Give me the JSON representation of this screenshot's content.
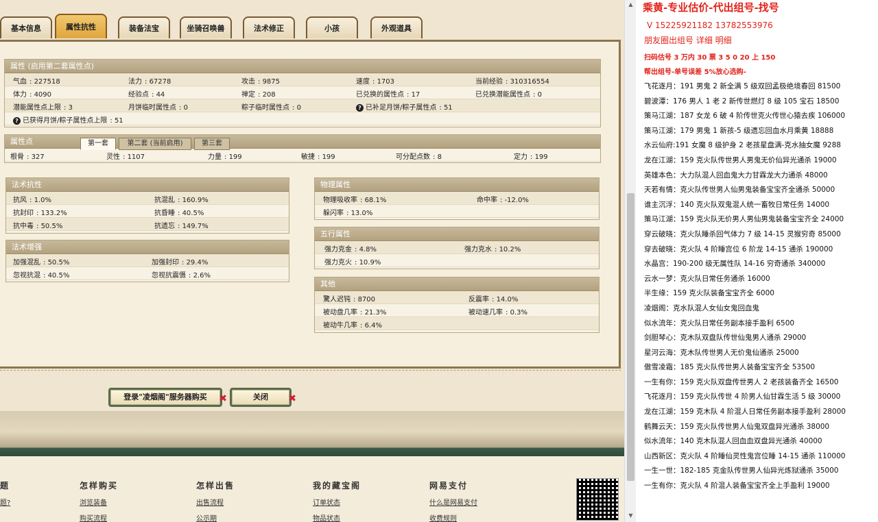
{
  "tabs": [
    "基本信息",
    "属性抗性",
    "装备法宝",
    "坐骑召唤兽",
    "法术修正",
    "小孩",
    "外观道具"
  ],
  "active_tab": 1,
  "attr_section": {
    "title": "属性 (启用第二套属性点)",
    "rows": [
      [
        [
          "气血",
          "227518"
        ],
        [
          "法力",
          "67278"
        ],
        [
          "攻击",
          "9875"
        ],
        [
          "速度",
          "1703"
        ],
        [
          "当前经验",
          "310316554"
        ]
      ],
      [
        [
          "体力",
          "4090"
        ],
        [
          "经验点",
          "44"
        ],
        [
          "禅定",
          "208"
        ],
        [
          "已兑换的属性点",
          "17"
        ],
        [
          "已兑换潜能属性点",
          "0"
        ]
      ],
      [
        [
          "潜能属性点上限",
          "3"
        ],
        [
          "月饼临时属性点",
          "0"
        ],
        [
          "粽子临时属性点",
          "0"
        ],
        [
          "已补足月饼/粽子属性点",
          "51"
        ]
      ],
      [
        [
          "已获得月饼/粽子属性点上限",
          "51"
        ]
      ]
    ]
  },
  "points_section": {
    "title": "属性点",
    "subtabs": [
      "第一套",
      "第二套 (当前启用)",
      "第三套"
    ],
    "cells": [
      [
        "根骨",
        "327"
      ],
      [
        "灵性",
        "1107"
      ],
      [
        "力量",
        "199"
      ],
      [
        "敏捷",
        "199"
      ],
      [
        "可分配点数",
        "8"
      ],
      [
        "定力",
        "199"
      ]
    ]
  },
  "spell_resist": {
    "title": "法术抗性",
    "rows": [
      [
        [
          "抗风",
          "1.0%"
        ],
        [
          "抗混乱",
          "160.9%"
        ]
      ],
      [
        [
          "抗封印",
          "133.2%"
        ],
        [
          "抗昏睡",
          "40.5%"
        ]
      ],
      [
        [
          "抗中毒",
          "50.5%"
        ],
        [
          "抗遗忘",
          "149.7%"
        ]
      ]
    ]
  },
  "spell_boost": {
    "title": "法术增强",
    "rows": [
      [
        [
          "加强混乱",
          "50.5%"
        ],
        [
          "加强封印",
          "29.4%"
        ]
      ],
      [
        [
          "忽视抗混",
          "40.5%"
        ],
        [
          "忽视抗震慑",
          "2.6%"
        ]
      ]
    ]
  },
  "phys": {
    "title": "物理属性",
    "rows": [
      [
        [
          "物理吸收率",
          "68.1%"
        ],
        [
          "命中率",
          "-12.0%"
        ]
      ],
      [
        [
          "躲闪率",
          "13.0%"
        ]
      ]
    ]
  },
  "five": {
    "title": "五行属性",
    "rows": [
      [
        [
          "强力克金",
          "4.8%"
        ],
        [
          "强力克水",
          "10.2%"
        ]
      ],
      [
        [
          "强力克火",
          "10.9%"
        ]
      ]
    ]
  },
  "other": {
    "title": "其他",
    "rows": [
      [
        [
          "驚人迟钝",
          "8700"
        ],
        [
          "反震率",
          "14.0%"
        ]
      ],
      [
        [
          "被动盘几率",
          "21.3%"
        ],
        [
          "被动速几率",
          "0.3%"
        ]
      ],
      [
        [
          "被动牛几率",
          "6.4%"
        ]
      ]
    ]
  },
  "buttons": {
    "buy": "登录\"凌烟阁\"服务器购买",
    "close": "关闭"
  },
  "footer": [
    {
      "title": "",
      "links": [
        "题?",
        ""
      ]
    },
    {
      "title": "怎样购买",
      "links": [
        "浏览装备",
        "购买流程"
      ]
    },
    {
      "title": "怎样出售",
      "links": [
        "出售流程",
        "公示期"
      ]
    },
    {
      "title": "我的藏宝阁",
      "links": [
        "订单状态",
        "物品状态"
      ]
    },
    {
      "title": "网易支付",
      "links": [
        "什么是网易支付",
        "收费规则"
      ]
    }
  ],
  "notes": {
    "title": "乘黄-专业估价-代出组号-找号",
    "phone": "V 15225921182   13782553976",
    "line3": "朋友圈出组号   详细   明细",
    "line4": "扫码估号 3 万内 30 票 3    5 0      20 上 150",
    "line5": "帮出组号-单号误差 5%放心选购-",
    "entries": [
      "飞花逐月：191 男鬼 2 新全满 5 级双回孟极绝境春回 81500",
      "碧波潭：176 男人 1 老 2 新传世燃灯 8 级 105 宝石 18500",
      "策马江湖：187 女龙 6 破 4 阶传世克火传世心猿去疾 106000",
      "策马江湖：179 男鬼 1 新孩-5 级遗忘回血水月乘黄 18888",
      "水云仙府:191 女魔 8 级护身 2 老孩星盘满-克水抽女魔 9288",
      "龙在江湖：159 克火队传世男人男鬼无价仙异光通杀 19000",
      "英雄本色：大力队混人回血鬼大力甘霖龙大力通杀 48000",
      "天若有情：克火队传世男人仙男鬼装备宝宝齐全通杀 50000",
      "谁主沉浮：140 克火队双鬼混人统一畜牧日常任务 14000",
      "策马江湖：159 克火队无价男人男仙男鬼装备宝宝齐全 24000",
      "穿云破晓：克火队睡杀回气体力 7 级 14-15 灵猴穷奇 85000",
      "穿去破晓：克火队 4 阶睡宫位 6 阶龙 14-15 通杀 190000",
      "水晶宫：190-200 级无属性队 14-16 穷奇通杀 340000",
      "云水一梦：克火队日常任务通杀 16000",
      "半生缘：159 克火队装备宝宝齐全 6000",
      "凌烟阁：克水队混人女仙女鬼回血鬼",
      "似水流年：克火队日常任务副本接手盈利 6500",
      "剑胆琴心：克木队双盘队传世仙鬼男人通杀 29000",
      "星河云海：克木队传世男人无价鬼仙通杀 25000",
      "傲雪凌霜：185 克火队传世男人装备宝宝齐全 53500",
      "一生有你：159 克火队双盘传世男人 2 老孩装备齐全 16500",
      "飞花逐月：159 克火队传世 4 阶男人仙甘霖生活 5 级 30000",
      "龙在江湖：159 克木队 4 阶混人日常任务副本接手盈利 28000",
      "鹤舞云天：159 克火队传世男人仙鬼双盘异光通杀 38000",
      "似水流年：140 克木队混人回血血双盘异光通杀 40000",
      "山西新区：克火队 4 阶睡仙灵性鬼宫位睡 14-15 通杀 110000",
      "一生一世：182-185 克金队传世男人仙异光炼狱通杀 35000",
      "一生有你：克火队 4 阶混人装备宝宝齐全上手盈利 19000"
    ]
  }
}
